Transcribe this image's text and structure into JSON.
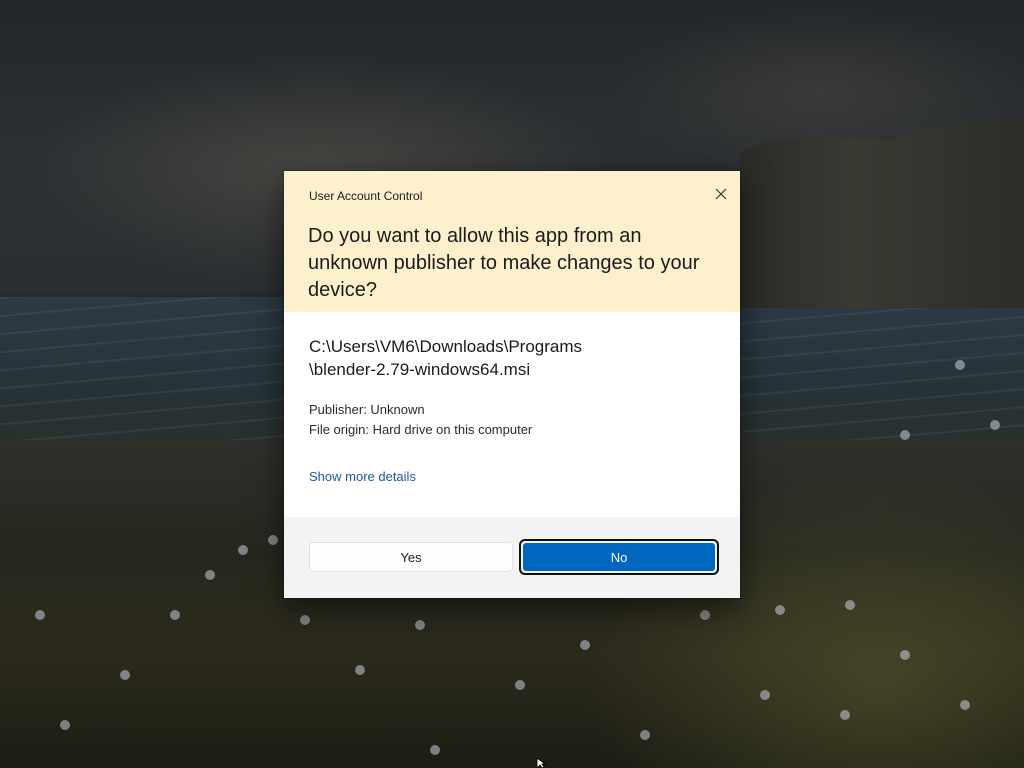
{
  "dialog": {
    "title": "User Account Control",
    "question": "Do you want to allow this app from an unknown publisher to make changes to your device?",
    "program_path_line1": "C:\\Users\\VM6\\Downloads\\Programs",
    "program_path_line2": "\\blender-2.79-windows64.msi",
    "publisher": "Publisher: Unknown",
    "file_origin": "File origin: Hard drive on this computer",
    "show_more_details": "Show more details",
    "close_icon": "close-icon"
  },
  "buttons": {
    "yes_label": "Yes",
    "no_label": "No"
  },
  "colors": {
    "header_background": "#fdf1cd",
    "primary_button": "#0067c0",
    "link": "#1c5aa0",
    "footer_background": "#f3f3f3"
  }
}
